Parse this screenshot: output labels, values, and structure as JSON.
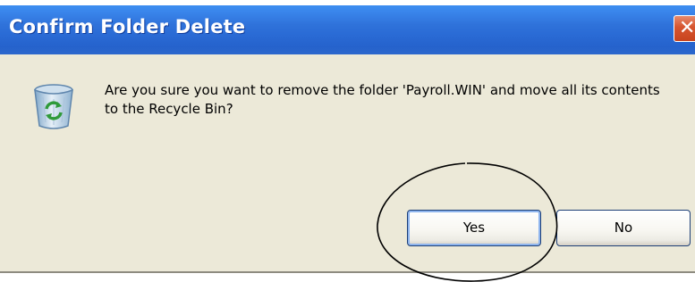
{
  "dialog": {
    "title": "Confirm Folder Delete",
    "close_glyph": "✕",
    "message": "Are you sure you want to remove the folder 'Payroll.WIN' and move all its contents to the Recycle Bin?",
    "icon": "recycle-bin-icon",
    "buttons": {
      "yes": "Yes",
      "no": "No"
    }
  },
  "colors": {
    "titlebar": "#2a6bd5",
    "dialog_background": "#ece9d8",
    "close_button": "#d6542e",
    "button_border": "#1d3f77"
  },
  "annotation": {
    "shape": "hand-drawn-circle",
    "around": "yes-button"
  }
}
